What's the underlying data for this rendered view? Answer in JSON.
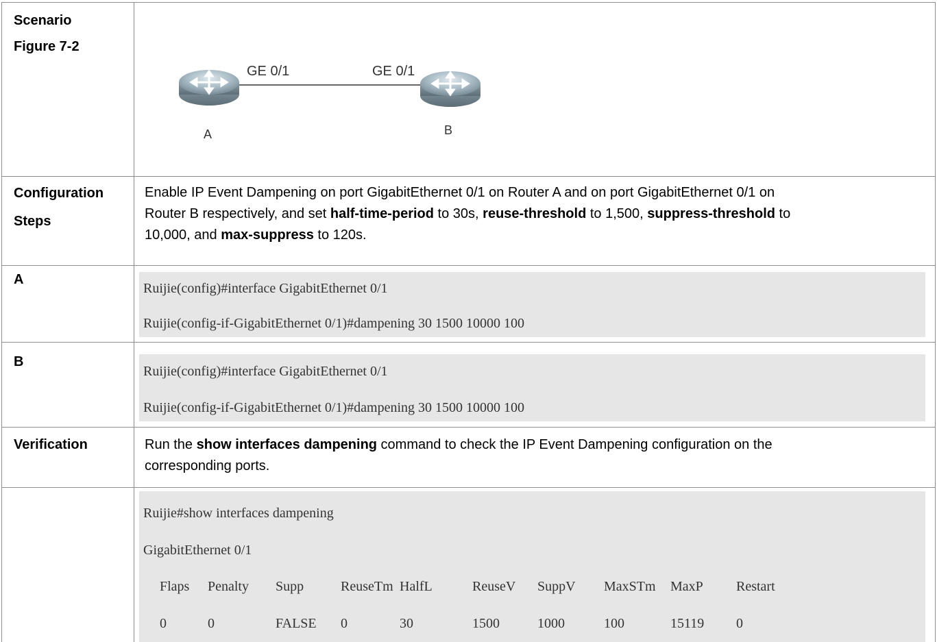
{
  "scenario": {
    "label": "Scenario",
    "figure_label": "Figure 7-2",
    "diagram": {
      "router_a_label": "A",
      "router_b_label": "B",
      "port_a": "GE 0/1",
      "port_b": "GE 0/1"
    }
  },
  "configuration": {
    "label_line1": "Configuration",
    "label_line2": "Steps",
    "line1": "Enable IP Event Dampening on port GigabitEthernet 0/1 on Router A and on port GigabitEthernet 0/1 on",
    "line2_pre": "Router B respectively, and set ",
    "half_time": "half-time-period",
    "line2_mid1": " to 30s, ",
    "reuse": "reuse-threshold",
    "line2_mid2": " to 1,500, ",
    "suppress": "suppress-threshold",
    "line2_post": " to",
    "line3_pre": "10,000, and ",
    "max_suppress": "max-suppress",
    "line3_post": " to 120s."
  },
  "router_a": {
    "label": "A",
    "cmd1": "Ruijie(config)#interface GigabitEthernet 0/1",
    "cmd2": "Ruijie(config-if-GigabitEthernet 0/1)#dampening 30 1500 10000 100"
  },
  "router_b": {
    "label": "B",
    "cmd1": "Ruijie(config)#interface GigabitEthernet 0/1",
    "cmd2": "Ruijie(config-if-GigabitEthernet 0/1)#dampening 30 1500 10000 100"
  },
  "verification": {
    "label": "Verification",
    "line1_pre": "Run the ",
    "command": "show interfaces dampening",
    "line1_post": " command to check the IP Event Dampening configuration on the",
    "line2": "corresponding ports.",
    "output": {
      "cmd": "Ruijie#show interfaces dampening",
      "interface": "GigabitEthernet 0/1",
      "headers": [
        "Flaps",
        "Penalty",
        "Supp",
        "ReuseTm",
        "HalfL",
        "ReuseV",
        "SuppV",
        "MaxSTm",
        "MaxP",
        "Restart"
      ],
      "values": [
        "0",
        "0",
        "FALSE",
        "0",
        "30",
        "1500",
        "1000",
        "100",
        "15119",
        "0"
      ]
    }
  }
}
